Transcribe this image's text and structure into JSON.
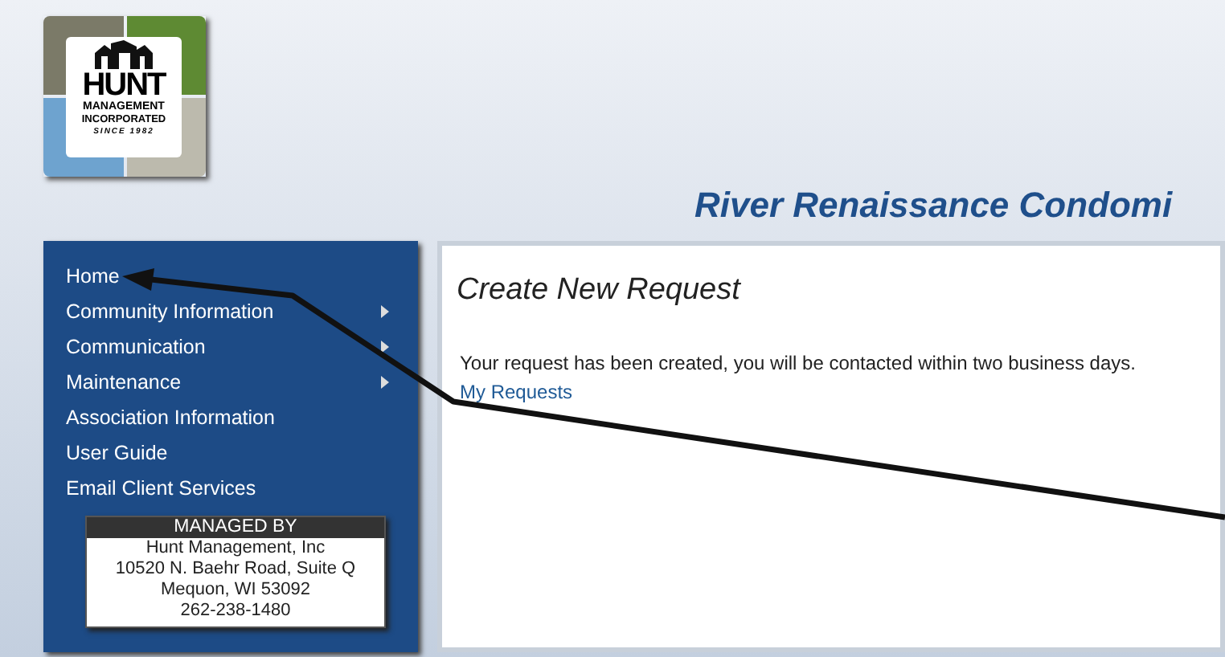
{
  "logo": {
    "name": "HUNT",
    "line_1": "MANAGEMENT",
    "line_2": "INCORPORATED",
    "line_3": "SINCE 1982"
  },
  "site_title": "River Renaissance Condomi",
  "sidebar": {
    "items": [
      {
        "label": "Home",
        "kind": "link"
      },
      {
        "label": "Community Information",
        "kind": "submenu"
      },
      {
        "label": "Communication",
        "kind": "submenu"
      },
      {
        "label": "Maintenance",
        "kind": "submenu"
      },
      {
        "label": "Association Information",
        "kind": "link"
      },
      {
        "label": "User Guide",
        "kind": "link"
      },
      {
        "label": "Email Client Services",
        "kind": "link"
      }
    ],
    "managed_by": {
      "heading": "MANAGED BY",
      "lines": [
        "Hunt Management, Inc",
        "10520 N. Baehr Road, Suite Q",
        "Mequon, WI 53092",
        "262-238-1480"
      ]
    }
  },
  "content": {
    "title": "Create New Request",
    "message": "Your request has been created, you will be contacted within two business days.",
    "link": "My Requests"
  }
}
